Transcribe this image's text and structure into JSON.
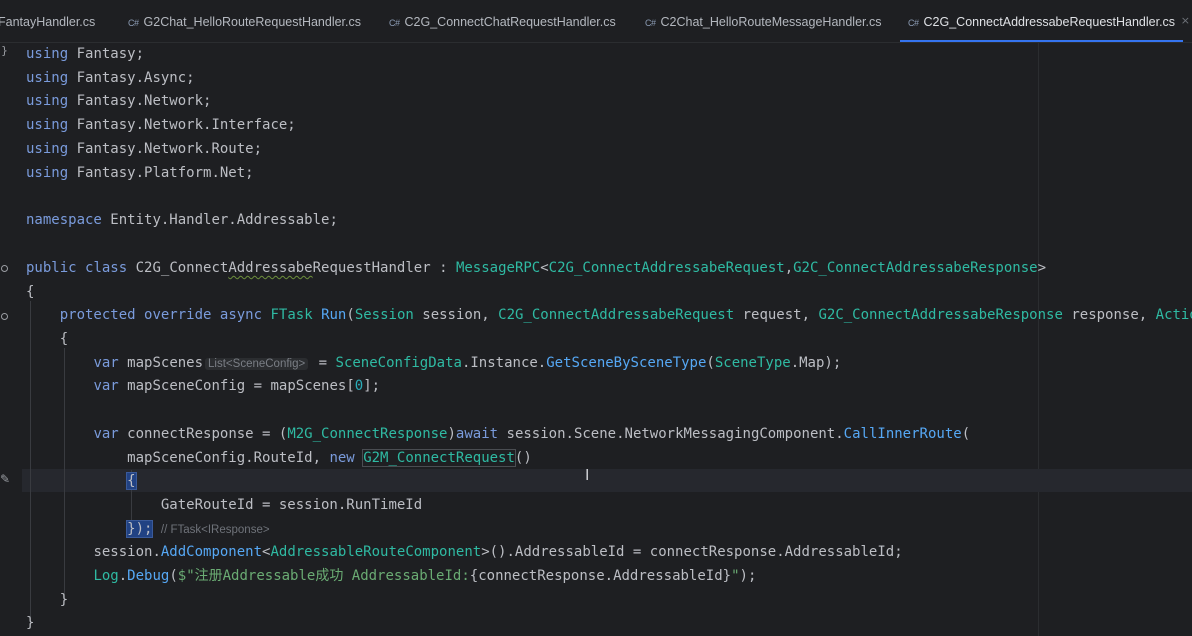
{
  "tabs": [
    {
      "prefix": "",
      "label": "FantayHandler.cs"
    },
    {
      "prefix": "C#",
      "label": "G2Chat_HelloRouteRequestHandler.cs"
    },
    {
      "prefix": "C#",
      "label": "C2G_ConnectChatRequestHandler.cs"
    },
    {
      "prefix": "C#",
      "label": "C2Chat_HelloRouteMessageHandler.cs"
    },
    {
      "prefix": "C#",
      "label": "C2G_ConnectAddressabeRequestHandler.cs",
      "active": true
    }
  ],
  "tab_more": "×",
  "gutter": {
    "top_brace": "}"
  },
  "code": {
    "using_kw": "using",
    "usings": [
      "Fantasy;",
      "Fantasy.Async;",
      "Fantasy.Network;",
      "Fantasy.Network.Interface;",
      "Fantasy.Network.Route;",
      "Fantasy.Platform.Net;"
    ],
    "ns_kw": "namespace",
    "ns_name": "Entity.Handler.Addressable;",
    "class_kw1": "public",
    "class_kw2": "class",
    "class_name_pre": "C2G_Connect",
    "class_name_squig": "Addressabe",
    "class_name_post": "RequestHandler",
    "colon": " : ",
    "base_type": "MessageRPC",
    "base_args": [
      "C2G_ConnectAddressabeRequest",
      "G2C_ConnectAddressabeResponse"
    ],
    "open_brace": "{",
    "close_brace": "}",
    "m_kw1": "protected",
    "m_kw2": "override",
    "m_kw3": "async",
    "m_ret": "FTask",
    "m_name": "Run",
    "p1_type": "Session",
    "p1_name": "session",
    "p2_type": "C2G_ConnectAddressabeRequest",
    "p2_name": "request",
    "p3_type": "G2C_ConnectAddressabeResponse",
    "p3_name": "response",
    "p4_partial": "Actio",
    "var_kw": "var",
    "v1_name": "mapScenes",
    "v1_hint": "List<SceneConfig>",
    "v1_rhs_type": "SceneConfigData",
    "v1_rhs_mid": ".Instance.",
    "v1_method": "GetSceneBySceneType",
    "v1_arg_type": "SceneType",
    "v1_arg_rest": ".Map);",
    "v2_name": "mapSceneConfig",
    "v2_rhs": "mapScenes[",
    "v2_idx": "0",
    "v2_end": "];",
    "v3_name": "connectResponse",
    "v3_cast": "M2G_ConnectResponse",
    "v3_await": "await",
    "v3_obj": "session.Scene.NetworkMessagingComponent.",
    "v3_method": "CallInnerRoute",
    "arg1": "mapSceneConfig.RouteId, ",
    "new_kw": "new",
    "new_type": "G2M_ConnectRequest",
    "new_parens": "()",
    "init_field": "GateRouteId",
    "init_rest": " = session.RunTimeId",
    "close_call": "});",
    "close_hint": "// FTask<IResponse>",
    "add_obj": "session.",
    "add_method": "AddComponent",
    "add_type": "AddressableRouteComponent",
    "add_rest": ">().AddressableId = connectResponse.AddressableId;",
    "log_type": "Log",
    "log_method": "Debug",
    "log_str1": "$\"注册Addressable成功 AddressableId:",
    "log_interp": "{connectResponse.AddressableId}",
    "log_str2": "\"",
    "log_end": ");"
  },
  "cursor_glyph": "I",
  "pencil_glyph": "✎"
}
